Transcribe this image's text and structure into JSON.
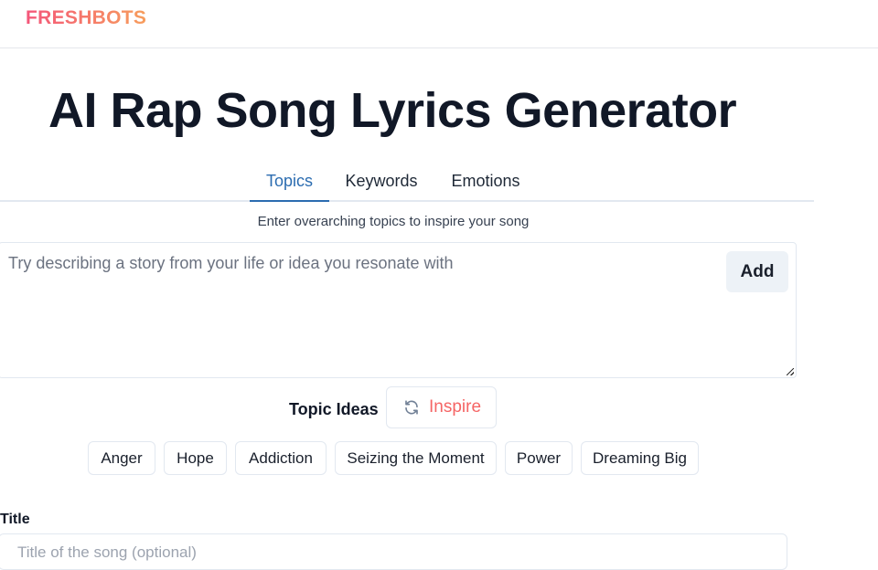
{
  "header": {
    "logo": "FRESHBOTS"
  },
  "page": {
    "title": "AI Rap Song Lyrics Generator"
  },
  "tabs": [
    {
      "label": "Topics",
      "active": true
    },
    {
      "label": "Keywords",
      "active": false
    },
    {
      "label": "Emotions",
      "active": false
    }
  ],
  "topics_panel": {
    "helper_text": "Enter overarching topics to inspire your song",
    "input_placeholder": "Try describing a story from your life or idea you resonate with",
    "input_value": "",
    "add_label": "Add",
    "ideas_label": "Topic Ideas",
    "inspire_label": "Inspire",
    "inspire_icon": "refresh-icon",
    "ideas": [
      "Anger",
      "Hope",
      "Addiction",
      "Seizing the Moment",
      "Power",
      "Dreaming Big"
    ]
  },
  "title_field": {
    "label": "Title",
    "placeholder": "Title of the song (optional)",
    "value": ""
  },
  "colors": {
    "accent": "#2b6cb0",
    "inspire": "#f56565",
    "logo_gradient_start": "#f4567a",
    "logo_gradient_end": "#f79d5c"
  }
}
